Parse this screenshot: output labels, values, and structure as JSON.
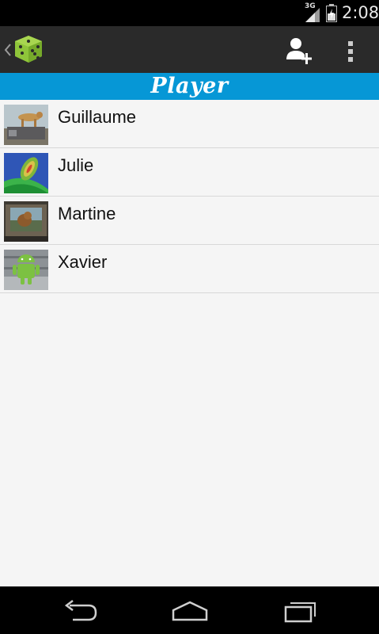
{
  "status_bar": {
    "network_label": "3G",
    "time": "2:08",
    "icons": [
      "signal-icon",
      "battery-icon"
    ]
  },
  "action_bar": {
    "icons": [
      "up-caret-icon",
      "dice-app-icon",
      "add-user-icon",
      "overflow-menu-icon"
    ],
    "accent_color": "#8fc53a"
  },
  "screen": {
    "title": "Player",
    "title_bg": "#0697d6"
  },
  "players": [
    {
      "name": "Guillaume",
      "thumbnail": "cheetah-car-photo"
    },
    {
      "name": "Julie",
      "thumbnail": "abstract-green-photo"
    },
    {
      "name": "Martine",
      "thumbnail": "animal-window-photo"
    },
    {
      "name": "Xavier",
      "thumbnail": "android-robot-photo"
    }
  ],
  "nav_bar": {
    "icons": [
      "back-icon",
      "home-icon",
      "recent-apps-icon"
    ]
  }
}
